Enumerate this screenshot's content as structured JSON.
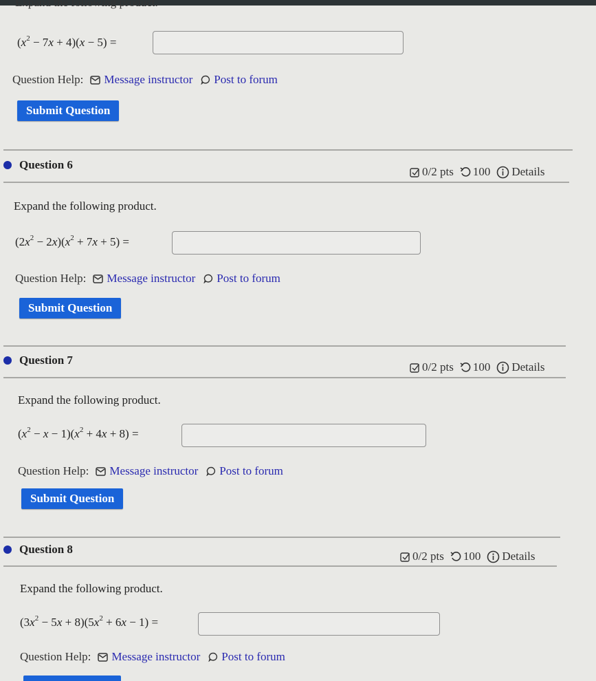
{
  "top_prompt": "Expand the following product.",
  "question_help_label": "Question Help:",
  "message_instructor": "Message instructor",
  "post_to_forum": "Post to forum",
  "submit_label": "Submit Question",
  "prev_question": {
    "expression_html": "(<i>x</i><sup>2</sup> &minus; 7<i>x</i> + 4)(<i>x</i> &minus; 5) =",
    "answer_value": ""
  },
  "questions": [
    {
      "title": "Question 6",
      "points": "0/2 pts",
      "attempts": "100",
      "details": "Details",
      "prompt": "Expand the following product.",
      "expression_html": "(2<i>x</i><sup>2</sup> &minus; 2<i>x</i>)(<i>x</i><sup>2</sup> + 7<i>x</i> + 5) =",
      "answer_value": ""
    },
    {
      "title": "Question 7",
      "points": "0/2 pts",
      "attempts": "100",
      "details": "Details",
      "prompt": "Expand the following product.",
      "expression_html": "(<i>x</i><sup>2</sup> &minus; <i>x</i> &minus; 1)(<i>x</i><sup>2</sup> + 4<i>x</i> + 8) =",
      "answer_value": ""
    },
    {
      "title": "Question 8",
      "points": "0/2 pts",
      "attempts": "100",
      "details": "Details",
      "prompt": "Expand the following product.",
      "expression_html": "(3<i>x</i><sup>2</sup> &minus; 5<i>x</i> + 8)(5<i>x</i><sup>2</sup> + 6<i>x</i> &minus; 1) =",
      "answer_value": ""
    }
  ],
  "colors": {
    "accent": "#1a63d8",
    "link": "#2a2ab0",
    "bullet": "#1c2ea8"
  }
}
